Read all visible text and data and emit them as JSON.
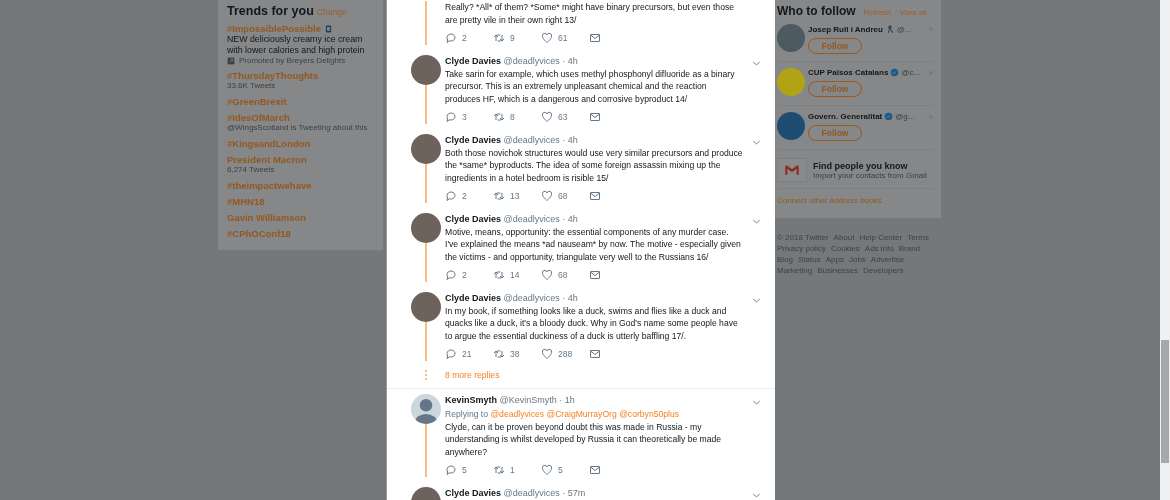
{
  "trends": {
    "title": "Trends for you",
    "change_link": "Change",
    "items": [
      {
        "name": "#ImpossiblePossible",
        "description": "NEW deliciously creamy ice cream with lower calories and high protein",
        "promoted": "Promoted by Breyers Delights"
      },
      {
        "name": "#ThursdayThoughts",
        "meta": "33.6K Tweets"
      },
      {
        "name": "#GreenBrexit"
      },
      {
        "name": "#IdesOfMarch",
        "meta": "@WingsScotland is Tweeting about this"
      },
      {
        "name": "#KingsandLondon"
      },
      {
        "name": "President Macron",
        "meta": "6,274 Tweets"
      },
      {
        "name": "#theimpactwehave"
      },
      {
        "name": "#MHN18"
      },
      {
        "name": "Gavin Williamson"
      },
      {
        "name": "#CPhOConf18"
      }
    ]
  },
  "thread": {
    "tweets": [
      {
        "kind": "cut",
        "text": "Really?  *All* of them?  *Some* might have binary precursors, but even those are pretty vile in their own right 13/",
        "replies": "2",
        "retweets": "9",
        "likes": "61"
      },
      {
        "kind": "thread",
        "name": "Clyde Davies",
        "handle": "@deadlyvices",
        "time": "· 4h",
        "text": "Take sarin for example, which uses methyl phosphonyl difluoride as a binary precursor.  This is an extremely unpleasant chemical and the reaction produces HF, which is a dangerous and corrosive byproduct 14/",
        "replies": "3",
        "retweets": "8",
        "likes": "63"
      },
      {
        "kind": "thread",
        "name": "Clyde Davies",
        "handle": "@deadlyvices",
        "time": "· 4h",
        "text": "Both those novichok structures would use very similar precursors and produce the *same* byproducts.  The idea of some foreign assassin mixing up the ingredients in a  hotel bedroom is risible 15/",
        "replies": "2",
        "retweets": "13",
        "likes": "68"
      },
      {
        "kind": "thread",
        "name": "Clyde Davies",
        "handle": "@deadlyvices",
        "time": "· 4h",
        "text": "Motive, means, opportunity:  the essential components of any murder case.  I've explained the means *ad nauseam* by now.  The motive - especially given the victims - and opportunity, triangulate very well to the Russians 16/",
        "replies": "2",
        "retweets": "14",
        "likes": "68"
      },
      {
        "kind": "thread",
        "name": "Clyde Davies",
        "handle": "@deadlyvices",
        "time": "· 4h",
        "text": "In my book, if something looks like a duck, swims and flies like a duck and quacks like a duck, it's a bloody duck.  Why in God's name some people have to argue the essential duckiness of a duck is utterly baffling 17/.",
        "replies": "21",
        "retweets": "38",
        "likes": "288"
      },
      {
        "kind": "more",
        "text": "8 more replies"
      },
      {
        "kind": "reply",
        "name": "KevinSmyth",
        "handle": "@KevinSmyth",
        "time": "· 1h",
        "replying_label": "Replying to",
        "replying_to": [
          "@deadlyvices",
          "@CraigMurrayOrg",
          "@corbyn50plus"
        ],
        "text": "Clyde, can it be proven beyond doubt this was made in Russia - my understanding is whilst developed by Russia it can theoretically be made anywhere?",
        "replies": "5",
        "retweets": "1",
        "likes": "5"
      },
      {
        "kind": "header_only",
        "name": "Clyde Davies",
        "handle": "@deadlyvices",
        "time": "· 57m"
      }
    ]
  },
  "who_to_follow": {
    "title": "Who to follow",
    "links": [
      "· Refresh",
      "· View all"
    ],
    "users": [
      {
        "name": "Josep Rull i Andreu",
        "handle": "@...",
        "kind": "photo",
        "ribbon": true,
        "verified": false,
        "button": "Follow"
      },
      {
        "name": "CUP Països Catalans",
        "handle": "@c...",
        "kind": "cup",
        "ribbon": false,
        "verified": true,
        "button": "Follow"
      },
      {
        "name": "Govern. Generalitat",
        "handle": "@g...",
        "kind": "govern",
        "ribbon": false,
        "verified": true,
        "button": "Follow"
      }
    ],
    "find": {
      "title": "Find people you know",
      "subtitle": "Import your contacts from Gmail"
    },
    "connect_link": "Connect other address books"
  },
  "footer": {
    "links": [
      "© 2018 Twitter",
      "About",
      "Help Center",
      "Terms",
      "Privacy policy",
      "Cookies",
      "Ads info",
      "Brand",
      "Blog",
      "Status",
      "Apps",
      "Jobs",
      "Advertise",
      "Marketing",
      "Businesses",
      "Developers"
    ]
  }
}
